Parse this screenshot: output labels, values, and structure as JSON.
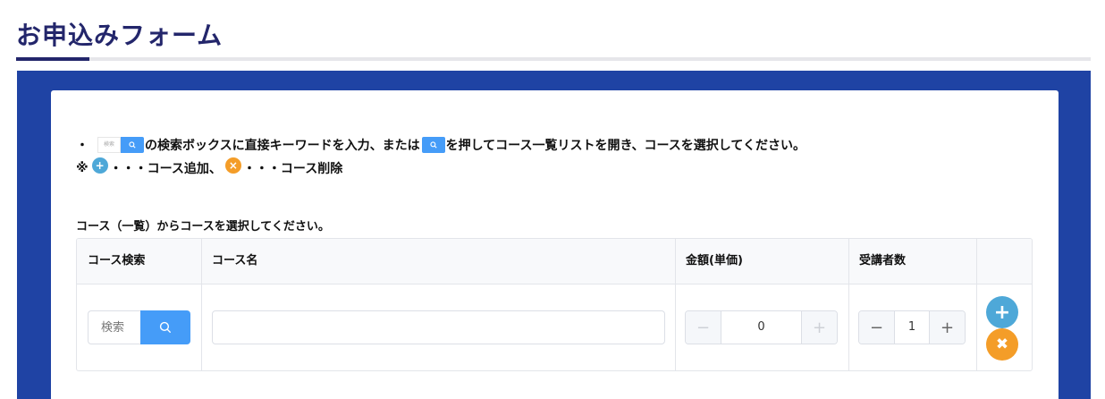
{
  "page": {
    "title": "お申込みフォーム"
  },
  "instructions": {
    "bullet": "・",
    "mini_search_placeholder": "検索",
    "line1_part1": "の検索ボックスに直接キーワードを入力、または",
    "line1_part2": "を押してコース一覧リストを開き、コースを選択してください。",
    "note_mark": "※",
    "add_symbol": "+",
    "add_text": "・・・コース追加、",
    "remove_symbol": "×",
    "remove_text": "・・・コース削除",
    "select_prompt": "コース（一覧）からコースを選択してください。"
  },
  "table": {
    "headers": {
      "search": "コース検索",
      "name": "コース名",
      "price": "金額(単価)",
      "attendees": "受講者数"
    },
    "row": {
      "search_placeholder": "検索",
      "course_name": "",
      "price": "0",
      "attendees": "1"
    },
    "icons": {
      "search": "search-icon",
      "minus": "minus-icon",
      "plus": "plus-icon",
      "add": "plus-circle-icon",
      "remove": "close-circle-icon"
    },
    "controls": {
      "minus_symbol": "−",
      "plus_symbol": "+",
      "add_symbol": "+",
      "remove_symbol": "✖"
    }
  },
  "colors": {
    "title": "#23266b",
    "band": "#1f43a4",
    "search_button": "#459cf8",
    "add_button": "#4ea8d8",
    "remove_button": "#f49d28"
  }
}
